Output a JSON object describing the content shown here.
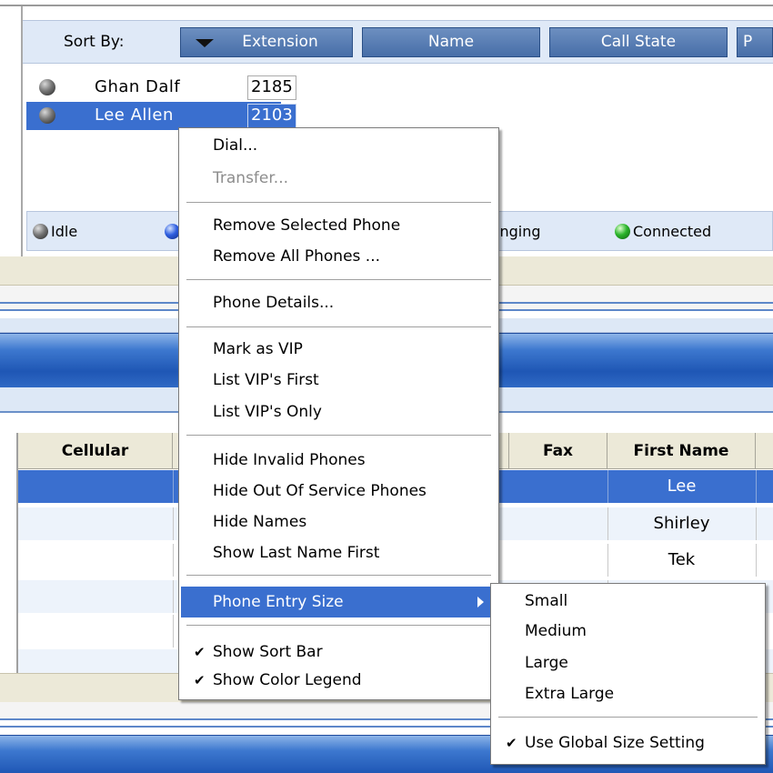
{
  "sort_bar": {
    "label": "Sort By:",
    "columns": [
      "Extension",
      "Name",
      "Call State",
      "P"
    ]
  },
  "phones": [
    {
      "name": "Ghan  Dalf",
      "ext": "2185",
      "selected": false
    },
    {
      "name": "Lee  Allen",
      "ext": "2103",
      "selected": true
    }
  ],
  "legend": {
    "items": [
      {
        "label": "Idle",
        "icon": "grey-ball-icon"
      },
      {
        "label": "",
        "icon": "blue-ball-icon"
      },
      {
        "label": "inging",
        "icon": ""
      },
      {
        "label": "Connected",
        "icon": "green-ball-icon"
      }
    ]
  },
  "table": {
    "headers": [
      "Cellular",
      "",
      "Fax",
      "First Name"
    ],
    "rows": [
      {
        "first_name": "Lee",
        "selected": true
      },
      {
        "first_name": "Shirley",
        "selected": false
      },
      {
        "first_name": "Tek",
        "selected": false
      }
    ]
  },
  "context_menu": {
    "items": [
      {
        "label": "Dial...",
        "enabled": true
      },
      {
        "label": "Transfer...",
        "enabled": false
      },
      {
        "label": "Remove Selected Phone",
        "enabled": true
      },
      {
        "label": "Remove All Phones ...",
        "enabled": true
      },
      {
        "label": "Phone Details...",
        "enabled": true
      },
      {
        "label": "Mark as VIP",
        "enabled": true
      },
      {
        "label": "List VIP's First",
        "enabled": true
      },
      {
        "label": "List VIP's Only",
        "enabled": true
      },
      {
        "label": "Hide Invalid Phones",
        "enabled": true
      },
      {
        "label": "Hide Out Of Service Phones",
        "enabled": true
      },
      {
        "label": "Hide Names",
        "enabled": true
      },
      {
        "label": "Show Last Name First",
        "enabled": true
      },
      {
        "label": "Phone Entry Size",
        "enabled": true,
        "highlighted": true,
        "submenu": true
      },
      {
        "label": "Show Sort Bar",
        "enabled": true,
        "checked": true
      },
      {
        "label": "Show Color Legend",
        "enabled": true,
        "checked": true
      }
    ]
  },
  "submenu": {
    "items": [
      {
        "label": "Small"
      },
      {
        "label": "Medium"
      },
      {
        "label": "Large"
      },
      {
        "label": "Extra Large"
      },
      {
        "label": "Use Global Size Setting",
        "checked": true
      }
    ]
  },
  "colors": {
    "selection": "#3a6fcf",
    "sort_button": "#5a7fb6",
    "panel_beige": "#ece9d8",
    "bar_light_blue": "#dfe9f7"
  }
}
